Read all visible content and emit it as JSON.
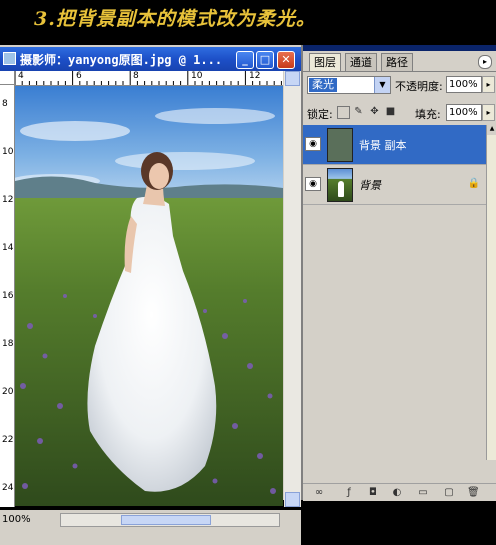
{
  "banner": {
    "text": "3.把背景副本的模式改为柔光。"
  },
  "document": {
    "title": "摄影师：yanyong原图.jpg @ 1...",
    "buttons": {
      "minimize": "_",
      "maximize": "□",
      "close": "✕"
    },
    "ruler_h_labels": [
      "4",
      "6",
      "8",
      "10",
      "12"
    ],
    "ruler_v_labels": [
      "8",
      "10",
      "12",
      "14",
      "16",
      "18",
      "20",
      "22",
      "24"
    ],
    "zoom": "100%",
    "icons": [
      "document-icon",
      "minimize-icon",
      "maximize-icon",
      "close-icon"
    ]
  },
  "layers_panel": {
    "tabs": [
      "图层",
      "通道",
      "路径"
    ],
    "blend_mode": "柔光",
    "opacity_label": "不透明度:",
    "opacity_value": "100%",
    "lock_label": "锁定:",
    "fill_label": "填充:",
    "fill_value": "100%",
    "layers": [
      {
        "name": "背景 副本",
        "selected": true
      },
      {
        "name": "背景",
        "selected": false,
        "locked": true
      }
    ],
    "colors": {
      "selection": "#316ac5",
      "panel": "#d4d0c8",
      "title_bar": "#1d50c8",
      "banner_text": "#e8c23a"
    }
  }
}
